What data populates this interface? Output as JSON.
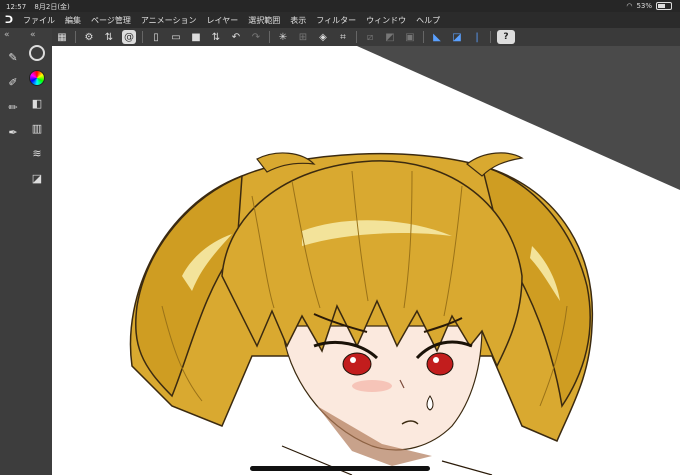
{
  "status_bar": {
    "time": "12:57",
    "date": "8月2日(金)",
    "battery": "53%"
  },
  "menu_bar": {
    "items": [
      "ファイル",
      "編集",
      "ページ管理",
      "アニメーション",
      "レイヤー",
      "選択範囲",
      "表示",
      "フィルター",
      "ウィンドウ",
      "ヘルプ"
    ]
  },
  "toolbar": {
    "help_label": "?"
  },
  "left_panel": {
    "collapse_left": "«",
    "collapse_right": "«"
  },
  "colors": {
    "canvas_bg": "#ffffff",
    "workspace_bg": "#4a4a4a",
    "hair_base": "#d9a930",
    "hair_highlight": "#f3e39a",
    "hair_shadow": "#9a7218",
    "skin": "#fbe9de",
    "eye": "#c21d1d"
  }
}
